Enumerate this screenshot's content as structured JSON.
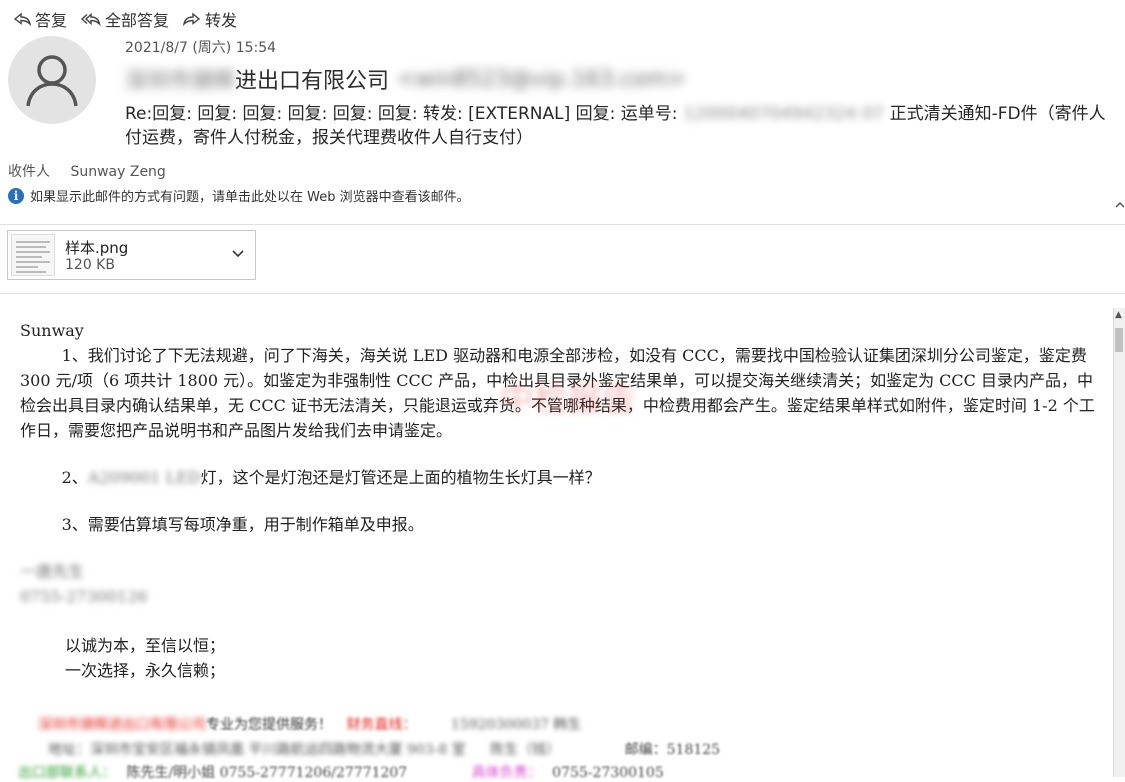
{
  "toolbar": {
    "reply": "答复",
    "reply_all": "全部答复",
    "forward": "转发"
  },
  "header": {
    "datetime": "2021/8/7 (周六) 15:54",
    "sender_company_visible": "进出口有限公司",
    "sender_company_blurred": "深圳市骐辉",
    "sender_email_blurred": "<win8523@vip.163.com>",
    "subject_prefix": "Re:回复: 回复: 回复: 回复: 回复: 回复: 转发: [EXTERNAL] 回复: 运单号:",
    "subject_blurred": "1200040704942324 07",
    "subject_suffix": "正式清关通知-FD件（寄件人付运费，寄件人付税金，报关代理费收件人自行支付）",
    "recipient_label": "收件人",
    "recipient_name": "Sunway Zeng",
    "info_text": "如果显示此邮件的方式有问题，请单击此处以在 Web 浏览器中查看该邮件。"
  },
  "attachment": {
    "name": "样本.png",
    "size": "120 KB"
  },
  "body": {
    "greeting": "Sunway",
    "p1": "1、我们讨论了下无法规避，问了下海关，海关说 LED 驱动器和电源全部涉检，如没有 CCC，需要找中国检验认证集团深圳分公司鉴定，鉴定费 300 元/项（6 项共计 1800 元）。如鉴定为非强制性 CCC 产品，中检出具目录外鉴定结果单，可以提交海关继续清关；如鉴定为 CCC 目录内产品，中检会出具目录内确认结果单，无 CCC 证书无法清关，只能退运或弃货。不管哪种结果，中检费用都会产生。鉴定结果单样式如附件，鉴定时间 1-2 个工作日，需要您把产品说明书和产品图片发给我们去申请鉴定。",
    "p2_prefix": "2、",
    "p2_blurred": "A209001 LED",
    "p2_suffix": "灯，这个是灯泡还是灯管还是上面的植物生长灯具一样？",
    "p3": "3、需要估算填写每项净重，用于制作箱单及申报。",
    "sig_name_blurred": "一唐先生",
    "sig_phone_blurred": "0755-27300126",
    "motto1": "以诚为本，至信以恒；",
    "motto2": "一次选择，永久信赖；",
    "footer1_red": "深圳市骐辉进出口有限公司",
    "footer1_mid": "专业为您提供服务！",
    "footer1_red2": "财务直线：",
    "footer1_num": "15920300037   韩生",
    "footer2_addr": "地址：深圳市宝安区福永镇凤凰 平川路航运四路物流大厦 903-8 室",
    "footer2_name": "陈生（钱）",
    "footer2_zip": "邮编：518125",
    "footer3_green": "出口部联系人：",
    "footer3_contact": "陈先生/明小姐 0755-27771206/27771207",
    "footer3_pink": "具体负责：",
    "footer3_num": "0755-27300105"
  },
  "watermark": "中检报告",
  "colors": {
    "accent_info": "#2a6fb8",
    "footer_red": "#e0201a",
    "footer_green": "#2e9c2e",
    "footer_pink": "#d040c8"
  }
}
